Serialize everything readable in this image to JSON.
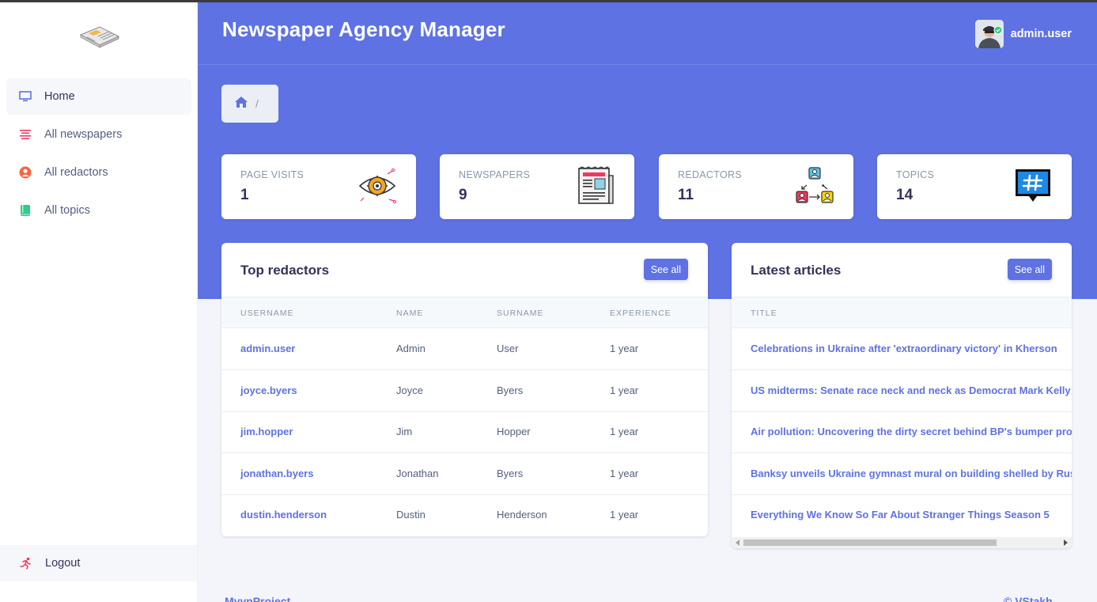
{
  "app": {
    "title": "Newspaper Agency Manager"
  },
  "user": {
    "name": "admin.user"
  },
  "sidebar": {
    "items": [
      {
        "label": "Home",
        "icon": "monitor-icon",
        "color": "#5e72e4",
        "active": true
      },
      {
        "label": "All newspapers",
        "icon": "align-lines-icon",
        "color": "#f5365c",
        "active": false
      },
      {
        "label": "All redactors",
        "icon": "user-circle-icon",
        "color": "#fb6340",
        "active": false
      },
      {
        "label": "All topics",
        "icon": "book-icon",
        "color": "#2dce89",
        "active": false
      }
    ],
    "logout": {
      "label": "Logout",
      "icon": "running-person-icon",
      "color": "#f5365c"
    }
  },
  "breadcrumb": {
    "separator": "/"
  },
  "stats": [
    {
      "label": "PAGE VISITS",
      "value": "1",
      "icon": "eye-gear-icon"
    },
    {
      "label": "NEWSPAPERS",
      "value": "9",
      "icon": "newspaper-icon"
    },
    {
      "label": "REDACTORS",
      "value": "11",
      "icon": "people-exchange-icon"
    },
    {
      "label": "TOPICS",
      "value": "14",
      "icon": "hashtag-icon"
    }
  ],
  "top_redactors": {
    "title": "Top redactors",
    "see_all": "See all",
    "columns": [
      "USERNAME",
      "NAME",
      "SURNAME",
      "EXPERIENCE"
    ],
    "rows": [
      {
        "username": "admin.user",
        "name": "Admin",
        "surname": "User",
        "experience": "1 year"
      },
      {
        "username": "joyce.byers",
        "name": "Joyce",
        "surname": "Byers",
        "experience": "1 year"
      },
      {
        "username": "jim.hopper",
        "name": "Jim",
        "surname": "Hopper",
        "experience": "1 year"
      },
      {
        "username": "jonathan.byers",
        "name": "Jonathan",
        "surname": "Byers",
        "experience": "1 year"
      },
      {
        "username": "dustin.henderson",
        "name": "Dustin",
        "surname": "Henderson",
        "experience": "1 year"
      }
    ]
  },
  "latest_articles": {
    "title": "Latest articles",
    "see_all": "See all",
    "columns": [
      "TITLE"
    ],
    "rows": [
      "Celebrations in Ukraine after 'extraordinary victory' in Kherson",
      "US midterms: Senate race neck and neck as Democrat Mark Kelly",
      "Air pollution: Uncovering the dirty secret behind BP's bumper pro",
      "Banksy unveils Ukraine gymnast mural on building shelled by Rus",
      "Everything We Know So Far About Stranger Things Season 5"
    ]
  },
  "footer": {
    "left": "MyynProject",
    "right": "© VStakh"
  },
  "colors": {
    "primary": "#5e72e4",
    "band": "#5e72e4",
    "text": "#32325d",
    "muted": "#8898aa"
  }
}
